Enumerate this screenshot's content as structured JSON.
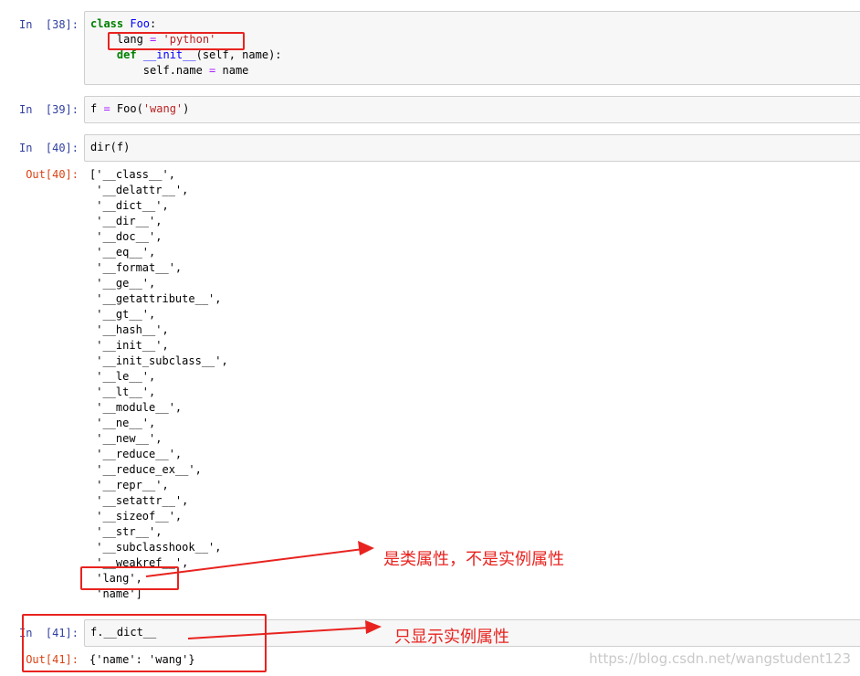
{
  "cells": [
    {
      "prompt": "In  [38]:",
      "code": [
        [
          {
            "t": "class ",
            "c": "kw"
          },
          {
            "t": "Foo",
            "c": "cls"
          },
          {
            "t": ":",
            "c": ""
          }
        ],
        [
          {
            "t": "    lang ",
            "c": ""
          },
          {
            "t": "=",
            "c": "op"
          },
          {
            "t": " ",
            "c": ""
          },
          {
            "t": "'python'",
            "c": "str"
          }
        ],
        [
          {
            "t": "    ",
            "c": ""
          },
          {
            "t": "def ",
            "c": "kw"
          },
          {
            "t": "__init__",
            "c": "cls"
          },
          {
            "t": "(self, name):",
            "c": ""
          }
        ],
        [
          {
            "t": "        self.name ",
            "c": ""
          },
          {
            "t": "=",
            "c": "op"
          },
          {
            "t": " name",
            "c": ""
          }
        ]
      ]
    },
    {
      "prompt": "In  [39]:",
      "code": [
        [
          {
            "t": "f ",
            "c": ""
          },
          {
            "t": "=",
            "c": "op"
          },
          {
            "t": " Foo(",
            "c": ""
          },
          {
            "t": "'wang'",
            "c": "str"
          },
          {
            "t": ")",
            "c": ""
          }
        ]
      ]
    },
    {
      "prompt": "In  [40]:",
      "code": [
        [
          {
            "t": "dir(f)",
            "c": ""
          }
        ]
      ],
      "out_prompt": "Out[40]:",
      "output": [
        "['__class__',",
        " '__delattr__',",
        " '__dict__',",
        " '__dir__',",
        " '__doc__',",
        " '__eq__',",
        " '__format__',",
        " '__ge__',",
        " '__getattribute__',",
        " '__gt__',",
        " '__hash__',",
        " '__init__',",
        " '__init_subclass__',",
        " '__le__',",
        " '__lt__',",
        " '__module__',",
        " '__ne__',",
        " '__new__',",
        " '__reduce__',",
        " '__reduce_ex__',",
        " '__repr__',",
        " '__setattr__',",
        " '__sizeof__',",
        " '__str__',",
        " '__subclasshook__',",
        " '__weakref__',",
        " 'lang',",
        " 'name']"
      ]
    },
    {
      "prompt": "In  [41]:",
      "code": [
        [
          {
            "t": "f.__dict__",
            "c": ""
          }
        ]
      ],
      "out_prompt": "Out[41]:",
      "output": [
        "{'name': 'wang'}"
      ]
    }
  ],
  "annotations": {
    "class_attr_note": "是类属性，不是实例属性",
    "instance_attr_note": "只显示实例属性",
    "color": "#e8231f"
  },
  "watermark": "https://blog.csdn.net/wangstudent123"
}
